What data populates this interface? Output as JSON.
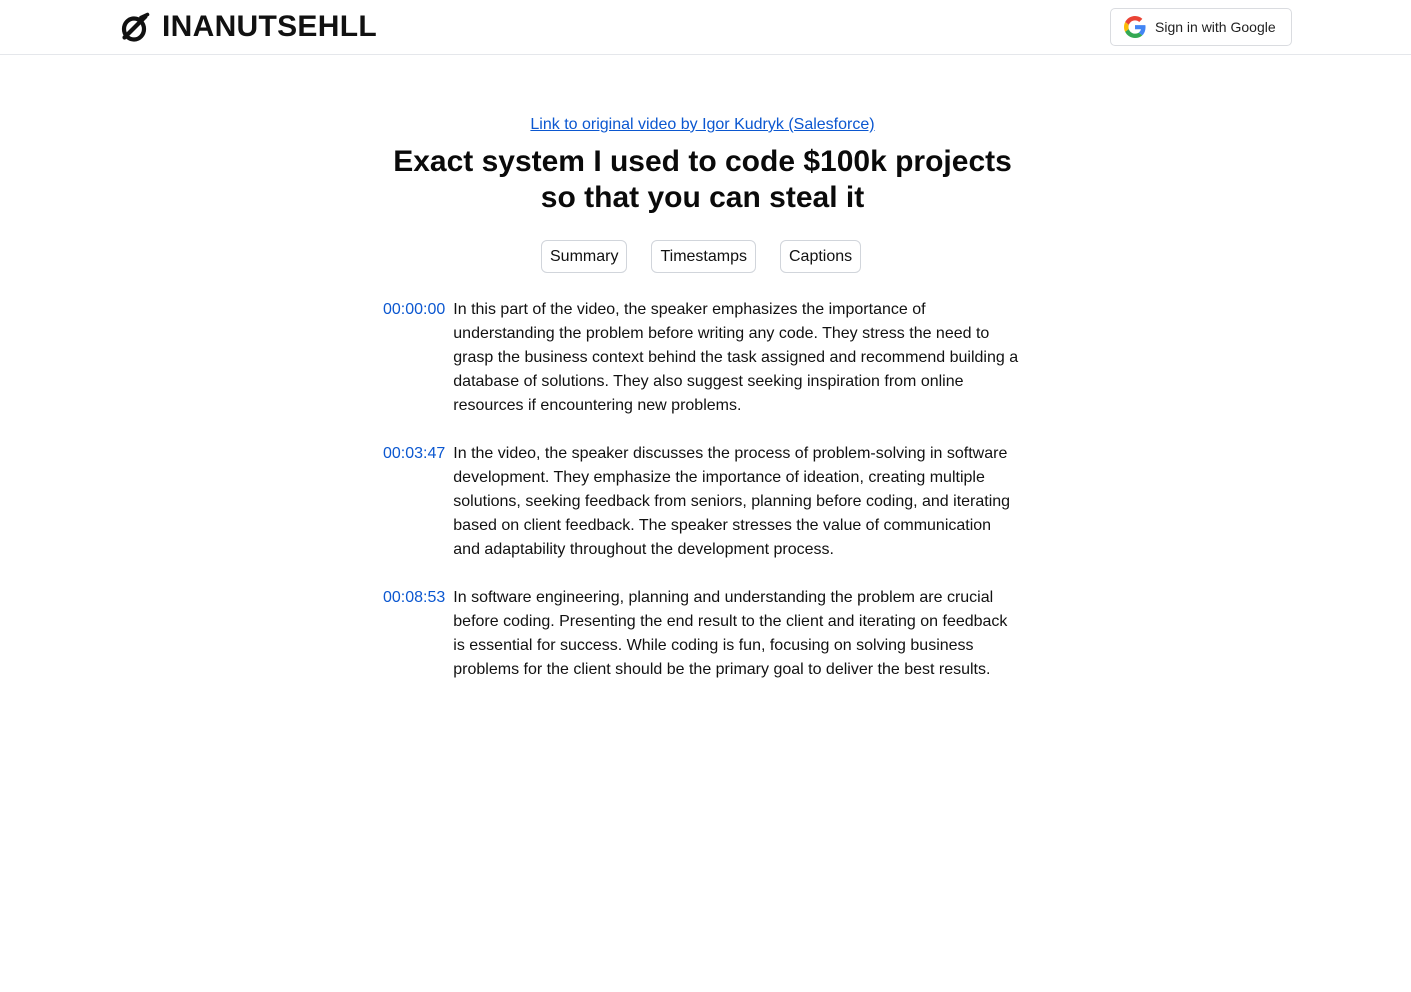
{
  "header": {
    "brand": "INANUTSEHLL",
    "signin_label": "Sign in with Google"
  },
  "video": {
    "source_link": "Link to original video by Igor Kudryk (Salesforce)",
    "title": "Exact system I used to code $100k projects so that you can steal it"
  },
  "tabs": [
    {
      "label": "Summary"
    },
    {
      "label": "Timestamps"
    },
    {
      "label": "Captions"
    }
  ],
  "entries": [
    {
      "timestamp": "00:00:00",
      "text": "In this part of the video, the speaker emphasizes the importance of understanding the problem before writing any code. They stress the need to grasp the business context behind the task assigned and recommend building a database of solutions. They also suggest seeking inspiration from online resources if encountering new problems."
    },
    {
      "timestamp": "00:03:47",
      "text": "In the video, the speaker discusses the process of problem-solving in software development. They emphasize the importance of ideation, creating multiple solutions, seeking feedback from seniors, planning before coding, and iterating based on client feedback. The speaker stresses the value of communication and adaptability throughout the development process."
    },
    {
      "timestamp": "00:08:53",
      "text": "In software engineering, planning and understanding the problem are crucial before coding. Presenting the end result to the client and iterating on feedback is essential for success. While coding is fun, focusing on solving business problems for the client should be the primary goal to deliver the best results."
    }
  ],
  "colors": {
    "link": "#0b57d0",
    "border": "#d1d5db"
  },
  "icons": {
    "logo": "nutshell-logo-icon",
    "google": "google-g-icon"
  }
}
